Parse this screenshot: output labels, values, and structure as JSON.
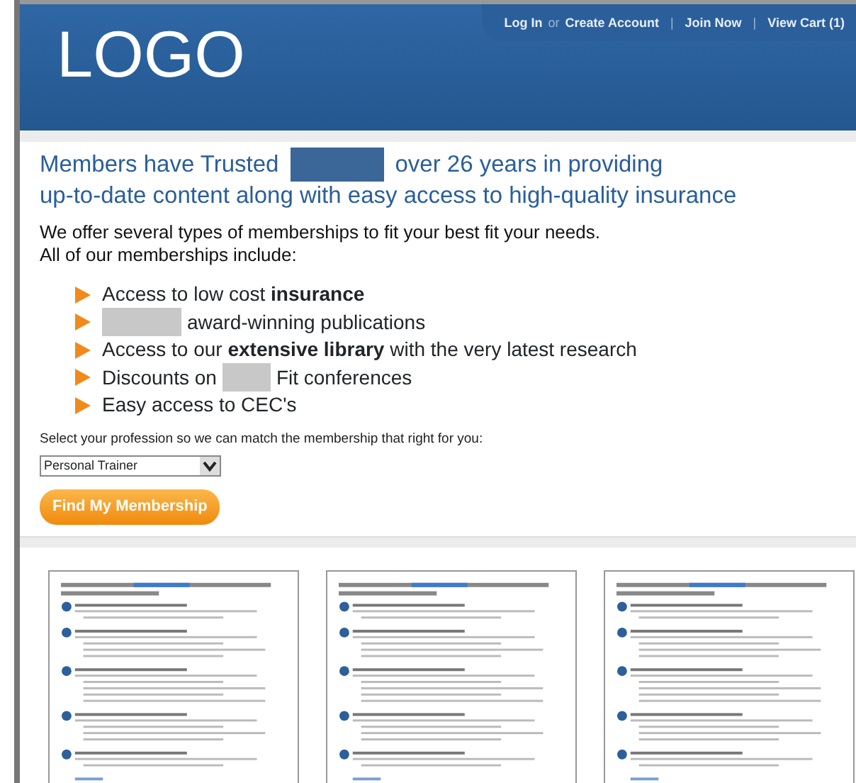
{
  "header": {
    "logo": "LOGO",
    "links": [
      {
        "kind": "link",
        "text": "Log In"
      },
      {
        "kind": "plain",
        "text": "or"
      },
      {
        "kind": "link",
        "text": "Create Account"
      },
      {
        "kind": "separator",
        "text": "|"
      },
      {
        "kind": "link",
        "text": "Join Now"
      },
      {
        "kind": "separator",
        "text": "|"
      },
      {
        "kind": "link",
        "text": "View Cart (1)"
      }
    ]
  },
  "heading": [
    {
      "kind": "text",
      "text": "Members have Trusted"
    },
    {
      "kind": "redacted",
      "color": "#3a6698"
    },
    {
      "kind": "text",
      "text": "over 26 years in providing"
    },
    {
      "kind": "break"
    },
    {
      "kind": "text",
      "text": "up-to-date content along with easy access to high-quality insurance"
    }
  ],
  "intro": "We offer several types of memberships to fit your best fit your needs.  All of our memberships include:",
  "benefits": [
    [
      {
        "kind": "text",
        "text": "Access to low cost **insurance**"
      }
    ],
    [
      {
        "kind": "redacted",
        "color": "#c8c8c8"
      },
      {
        "kind": "text",
        "text": "award-winning publications"
      }
    ],
    [
      {
        "kind": "text",
        "text": "Access to our **extensive library** with the very latest research"
      }
    ],
    [
      {
        "kind": "text",
        "text": "Discounts on"
      },
      {
        "kind": "redacted",
        "color": "#c8c8c8"
      },
      {
        "kind": "text",
        "text": "Fit conferences"
      }
    ],
    [
      {
        "kind": "text",
        "text": "Easy access to CEC's"
      }
    ]
  ],
  "select_label": "Select your profession so we can match the membership that right for you:",
  "profession_select": {
    "value": "Personal Trainer"
  },
  "find_button": "Find My Membership",
  "thumbnails": [
    {
      "kind": "picture"
    },
    {
      "kind": "picture"
    },
    {
      "kind": "picture"
    }
  ]
}
